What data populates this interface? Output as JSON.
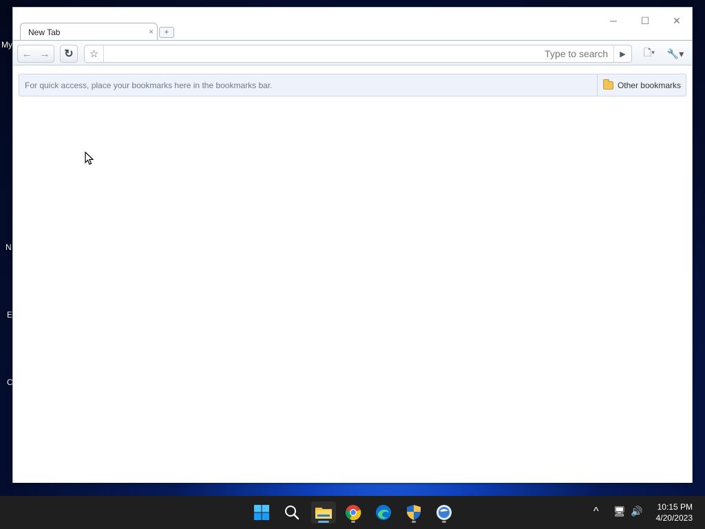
{
  "desktop": {
    "icon_labels": [
      "My",
      "N",
      "E",
      "C"
    ]
  },
  "window": {
    "controls": {
      "minimize": "─",
      "maximize": "☐",
      "close": "✕"
    }
  },
  "tabs": [
    {
      "title": "New Tab",
      "close_glyph": "×"
    }
  ],
  "new_tab_glyph": "+",
  "toolbar": {
    "back_glyph": "←",
    "forward_glyph": "→",
    "reload_glyph": "↻",
    "star_glyph": "☆",
    "omnibox_value": "",
    "search_hint": "Type to search",
    "go_glyph": "▶",
    "page_menu_glyph": "🗋▾",
    "wrench_glyph": "🔧▾"
  },
  "bookmarks_bar": {
    "hint": "For quick access, place your bookmarks here in the bookmarks bar.",
    "other_bookmarks": "Other bookmarks"
  },
  "taskbar": {
    "apps": [
      {
        "name": "start",
        "icon": "windows-logo-icon"
      },
      {
        "name": "search",
        "icon": "search-icon"
      },
      {
        "name": "file-explorer",
        "icon": "folder-icon"
      },
      {
        "name": "chrome",
        "icon": "chrome-icon"
      },
      {
        "name": "edge",
        "icon": "edge-icon"
      },
      {
        "name": "security",
        "icon": "shield-icon"
      },
      {
        "name": "app",
        "icon": "globe-icon"
      }
    ],
    "tray": {
      "chevron": "^",
      "network": "🖥",
      "volume": "🔊"
    },
    "time": "10:15 PM",
    "date": "4/20/2023"
  },
  "colors": {
    "accent": "#5fb2f2",
    "bookmarks_bg": "#eef3fb",
    "taskbar_bg": "#1f1f1f"
  }
}
